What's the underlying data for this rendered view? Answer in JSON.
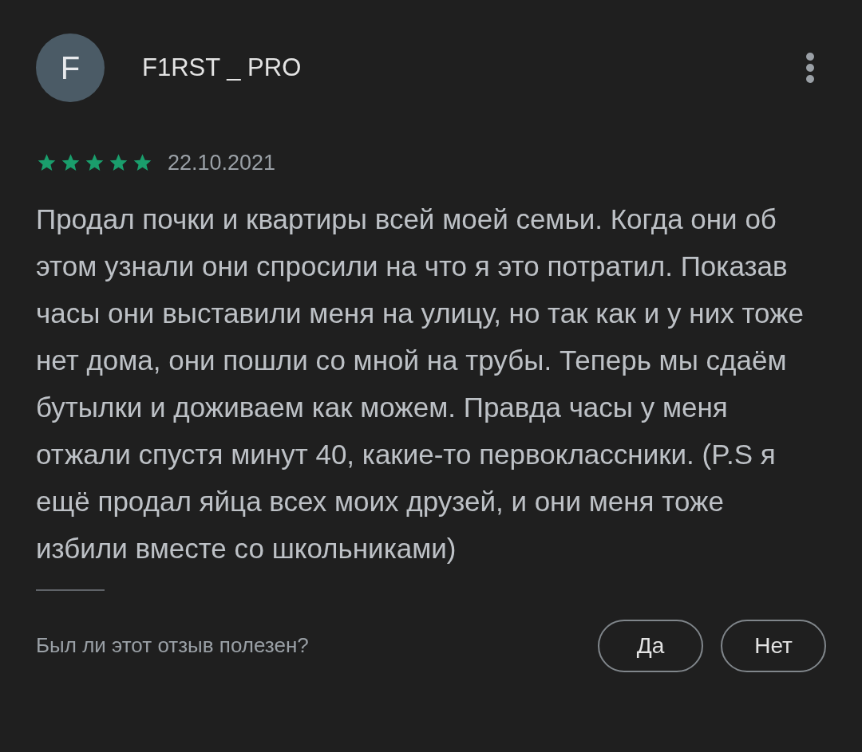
{
  "review": {
    "avatar_letter": "F",
    "author": "F1RST _ PRO",
    "stars": 5,
    "date": "22.10.2021",
    "text": "Продал почки и квартиры всей моей семьи. Когда они об этом узнали они спросили на что я это потратил. Показав часы они выставили меня на улицу, но так как и у них тоже нет дома, они пошли со мной на трубы. Теперь мы сдаём бутылки и доживаем как можем. Правда часы у меня отжали спустя минут 40, какие-то первоклассники. (P.S я ещё продал яйца всех моих друзей, и они меня тоже избили вместе со школьниками)"
  },
  "feedback": {
    "question": "Был ли этот отзыв полезен?",
    "buttons": [
      "Да",
      "Нет"
    ]
  }
}
